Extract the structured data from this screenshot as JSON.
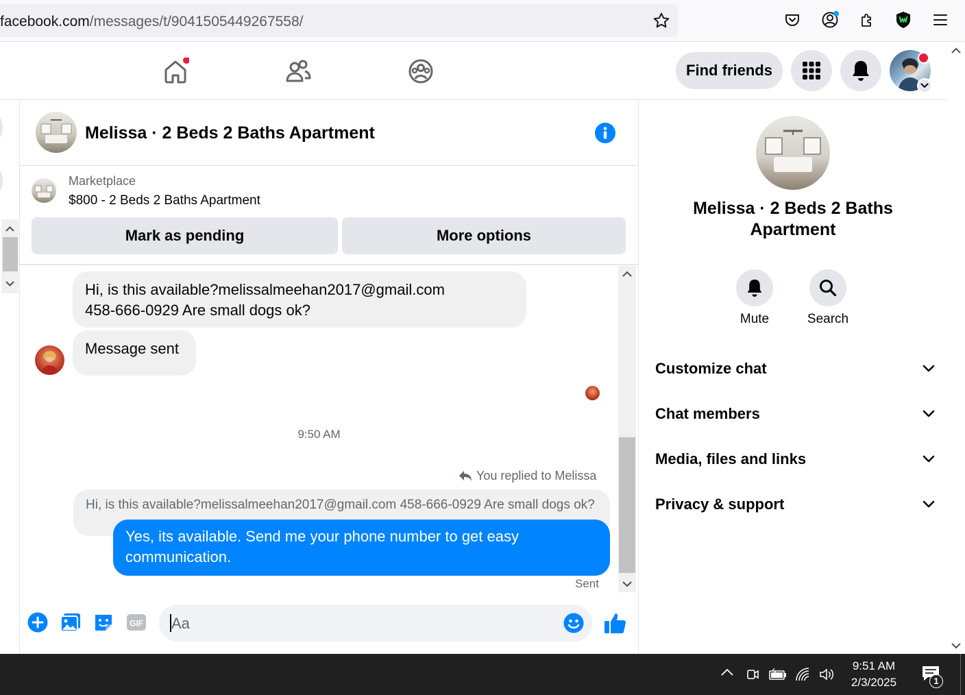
{
  "browser": {
    "url_domain": "facebook.com",
    "url_prefix": "",
    "url_path": "/messages/t/9041505449267558/"
  },
  "nav": {
    "find_friends": "Find friends"
  },
  "chat": {
    "title": "Melissa · 2 Beds 2 Baths Apartment",
    "listing_source": "Marketplace",
    "listing_title": "$800 - 2 Beds 2 Baths Apartment",
    "mark_pending": "Mark as pending",
    "more_options": "More options",
    "messages": {
      "incoming_1_line1": "Hi, is this available?melissalmeehan2017@gmail.com",
      "incoming_1_line2": "458-666-0929 Are small dogs ok?",
      "incoming_2": "Message sent",
      "timestamp": "9:50 AM",
      "reply_note": "You replied to Melissa",
      "quoted": "Hi, is this available?melissalmeehan2017@gmail.com 458-666-0929 Are small dogs ok?",
      "outgoing_line1": "Yes, its available. Send me your phone number to get easy",
      "outgoing_line2": "communication.",
      "status": "Sent"
    },
    "composer_placeholder": "Aa"
  },
  "details": {
    "name_line1": "Melissa · 2 Beds 2 Baths",
    "name_line2": "Apartment",
    "mute": "Mute",
    "search": "Search",
    "sections": [
      "Customize chat",
      "Chat members",
      "Media, files and links",
      "Privacy & support"
    ]
  },
  "taskbar": {
    "time": "9:51 AM",
    "date": "2/3/2025",
    "notif_count": "1"
  },
  "colors": {
    "accent": "#0084ff",
    "fb_blue": "#1877f2",
    "notification_red": "#e41e3f"
  }
}
